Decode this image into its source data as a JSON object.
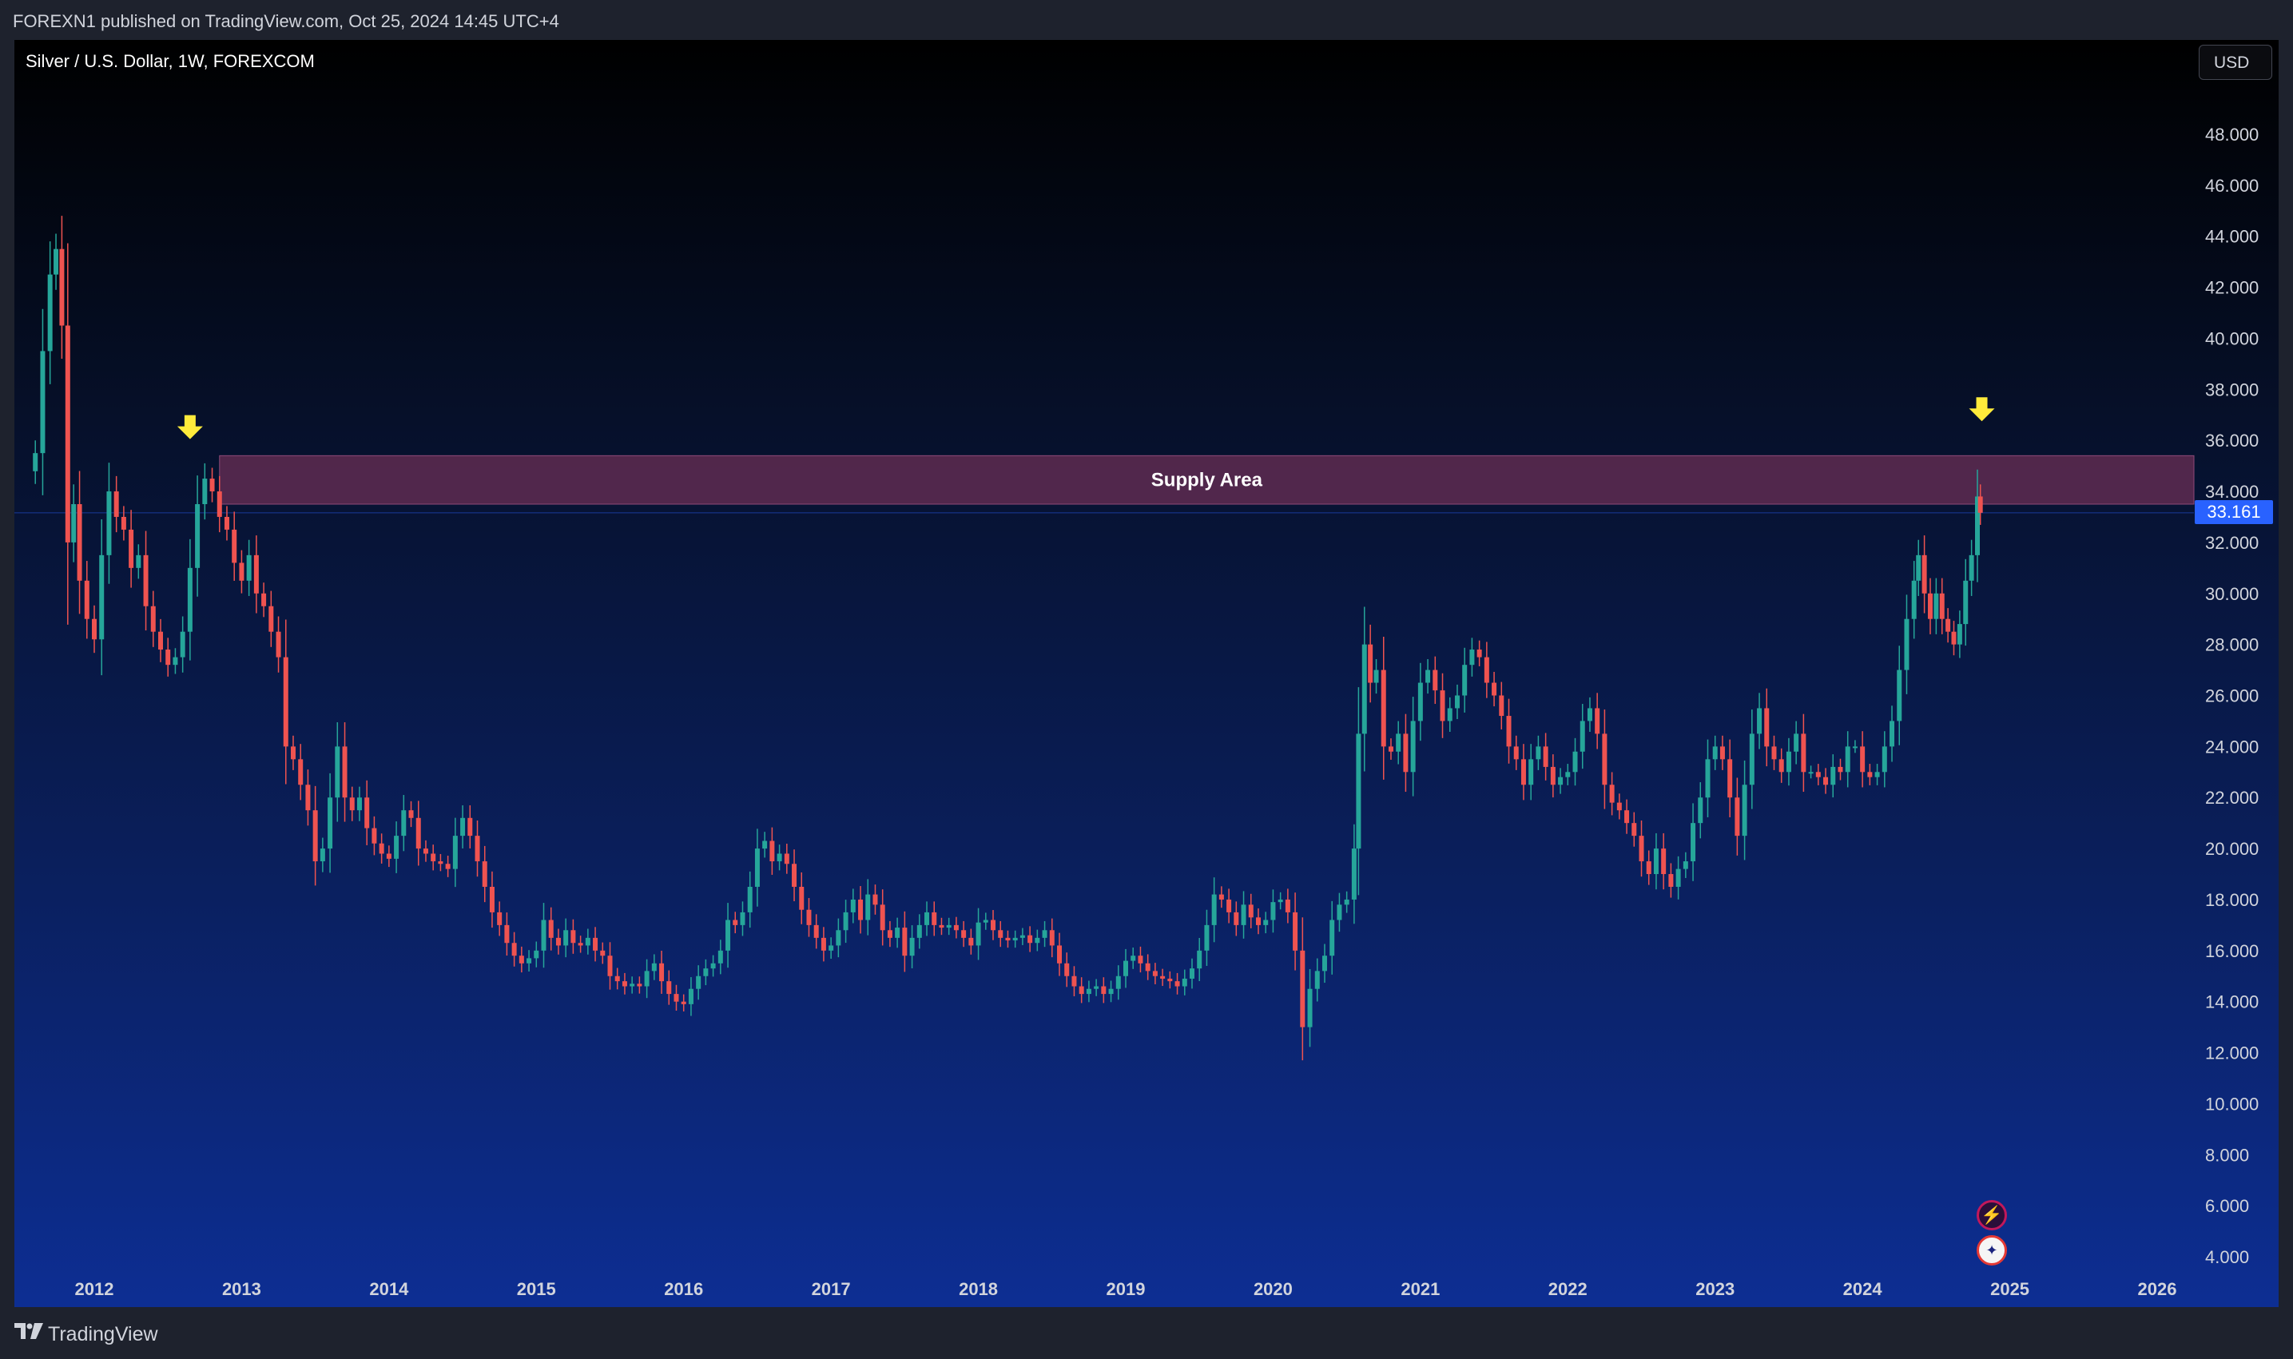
{
  "header": {
    "publish_text": "FOREXN1 published on TradingView.com, Oct 25, 2024 14:45 UTC+4"
  },
  "chart": {
    "symbol_title": "Silver / U.S. Dollar, 1W, FOREXCOM",
    "currency_label": "USD",
    "last_price_label": "33.161"
  },
  "footer": {
    "brand": "TradingView"
  },
  "icons": {
    "top_left": "tradingview-logo-icon",
    "events": [
      "lightning-icon",
      "us-flag-icon"
    ]
  },
  "colors": {
    "up_candle": "#26a69a",
    "down_candle": "#ef5350",
    "supply_zone_fill": "#6b2f55",
    "arrow": "#ffeb3b",
    "last_price": "#2962ff"
  },
  "chart_data": {
    "type": "candlestick",
    "title": "Silver / U.S. Dollar, 1W, FOREXCOM",
    "xlabel": "",
    "ylabel": "",
    "currency": "USD",
    "ylim": [
      4,
      50
    ],
    "yticks": [
      "48.000",
      "46.000",
      "44.000",
      "42.000",
      "40.000",
      "38.000",
      "36.000",
      "34.000",
      "32.000",
      "30.000",
      "28.000",
      "26.000",
      "24.000",
      "22.000",
      "20.000",
      "18.000",
      "16.000",
      "14.000",
      "12.000",
      "10.000",
      "8.000",
      "6.000",
      "4.000"
    ],
    "xlim": [
      2011.6,
      2026.3
    ],
    "xticks": [
      "2012",
      "2013",
      "2014",
      "2015",
      "2016",
      "2017",
      "2018",
      "2019",
      "2020",
      "2021",
      "2022",
      "2023",
      "2024",
      "2025",
      "2026"
    ],
    "last_price": 33.161,
    "series": [
      {
        "name": "",
        "points": [
          [
            2011.6,
            35.5
          ],
          [
            2011.65,
            39.5
          ],
          [
            2011.7,
            42.5
          ],
          [
            2011.74,
            43.5
          ],
          [
            2011.78,
            40.5
          ],
          [
            2011.82,
            32.0
          ],
          [
            2011.86,
            33.5
          ],
          [
            2011.9,
            30.5
          ],
          [
            2011.95,
            29.0
          ],
          [
            2012.0,
            28.2
          ],
          [
            2012.05,
            31.5
          ],
          [
            2012.1,
            34.0
          ],
          [
            2012.15,
            33.0
          ],
          [
            2012.2,
            32.5
          ],
          [
            2012.25,
            31.0
          ],
          [
            2012.3,
            31.5
          ],
          [
            2012.35,
            29.5
          ],
          [
            2012.4,
            28.5
          ],
          [
            2012.45,
            27.8
          ],
          [
            2012.5,
            27.2
          ],
          [
            2012.55,
            27.5
          ],
          [
            2012.6,
            28.5
          ],
          [
            2012.65,
            31.0
          ],
          [
            2012.7,
            33.5
          ],
          [
            2012.75,
            34.5
          ],
          [
            2012.8,
            34.0
          ],
          [
            2012.85,
            33.0
          ],
          [
            2012.9,
            32.5
          ],
          [
            2012.95,
            31.2
          ],
          [
            2013.0,
            30.5
          ],
          [
            2013.05,
            31.5
          ],
          [
            2013.1,
            30.0
          ],
          [
            2013.15,
            29.5
          ],
          [
            2013.2,
            28.5
          ],
          [
            2013.25,
            27.5
          ],
          [
            2013.3,
            24.0
          ],
          [
            2013.35,
            23.5
          ],
          [
            2013.4,
            22.5
          ],
          [
            2013.45,
            21.5
          ],
          [
            2013.5,
            19.5
          ],
          [
            2013.55,
            20.0
          ],
          [
            2013.6,
            22.0
          ],
          [
            2013.65,
            24.0
          ],
          [
            2013.7,
            22.0
          ],
          [
            2013.75,
            21.5
          ],
          [
            2013.8,
            22.0
          ],
          [
            2013.85,
            20.8
          ],
          [
            2013.9,
            20.2
          ],
          [
            2013.95,
            19.8
          ],
          [
            2014.0,
            19.6
          ],
          [
            2014.05,
            20.5
          ],
          [
            2014.1,
            21.5
          ],
          [
            2014.15,
            21.2
          ],
          [
            2014.2,
            20.0
          ],
          [
            2014.25,
            19.8
          ],
          [
            2014.3,
            19.5
          ],
          [
            2014.35,
            19.4
          ],
          [
            2014.4,
            19.2
          ],
          [
            2014.45,
            20.5
          ],
          [
            2014.5,
            21.2
          ],
          [
            2014.55,
            20.5
          ],
          [
            2014.6,
            19.5
          ],
          [
            2014.65,
            18.5
          ],
          [
            2014.7,
            17.5
          ],
          [
            2014.75,
            17.0
          ],
          [
            2014.8,
            16.3
          ],
          [
            2014.85,
            15.8
          ],
          [
            2014.9,
            15.5
          ],
          [
            2014.95,
            15.7
          ],
          [
            2015.0,
            16.0
          ],
          [
            2015.05,
            17.2
          ],
          [
            2015.1,
            16.5
          ],
          [
            2015.15,
            16.2
          ],
          [
            2015.2,
            16.8
          ],
          [
            2015.25,
            16.3
          ],
          [
            2015.3,
            16.2
          ],
          [
            2015.35,
            16.5
          ],
          [
            2015.4,
            16.0
          ],
          [
            2015.45,
            15.8
          ],
          [
            2015.5,
            15.0
          ],
          [
            2015.55,
            14.8
          ],
          [
            2015.6,
            14.6
          ],
          [
            2015.65,
            14.7
          ],
          [
            2015.7,
            14.6
          ],
          [
            2015.75,
            15.2
          ],
          [
            2015.8,
            15.5
          ],
          [
            2015.85,
            14.8
          ],
          [
            2015.9,
            14.3
          ],
          [
            2015.95,
            14.0
          ],
          [
            2016.0,
            13.9
          ],
          [
            2016.05,
            14.5
          ],
          [
            2016.1,
            15.0
          ],
          [
            2016.15,
            15.3
          ],
          [
            2016.2,
            15.5
          ],
          [
            2016.25,
            16.0
          ],
          [
            2016.3,
            17.2
          ],
          [
            2016.35,
            17.0
          ],
          [
            2016.4,
            17.5
          ],
          [
            2016.45,
            18.5
          ],
          [
            2016.5,
            20.0
          ],
          [
            2016.55,
            20.3
          ],
          [
            2016.6,
            19.5
          ],
          [
            2016.65,
            19.8
          ],
          [
            2016.7,
            19.4
          ],
          [
            2016.75,
            18.5
          ],
          [
            2016.8,
            17.6
          ],
          [
            2016.85,
            17.0
          ],
          [
            2016.9,
            16.5
          ],
          [
            2016.95,
            16.0
          ],
          [
            2017.0,
            16.2
          ],
          [
            2017.05,
            16.8
          ],
          [
            2017.1,
            17.5
          ],
          [
            2017.15,
            18.0
          ],
          [
            2017.2,
            17.2
          ],
          [
            2017.25,
            18.2
          ],
          [
            2017.3,
            17.8
          ],
          [
            2017.35,
            16.8
          ],
          [
            2017.4,
            16.5
          ],
          [
            2017.45,
            16.9
          ],
          [
            2017.5,
            15.8
          ],
          [
            2017.55,
            16.5
          ],
          [
            2017.6,
            17.0
          ],
          [
            2017.65,
            17.5
          ],
          [
            2017.7,
            17.0
          ],
          [
            2017.75,
            16.9
          ],
          [
            2017.8,
            17.0
          ],
          [
            2017.85,
            16.8
          ],
          [
            2017.9,
            16.5
          ],
          [
            2017.95,
            16.2
          ],
          [
            2018.0,
            17.1
          ],
          [
            2018.05,
            17.2
          ],
          [
            2018.1,
            16.8
          ],
          [
            2018.15,
            16.5
          ],
          [
            2018.2,
            16.4
          ],
          [
            2018.25,
            16.5
          ],
          [
            2018.3,
            16.6
          ],
          [
            2018.35,
            16.3
          ],
          [
            2018.4,
            16.5
          ],
          [
            2018.45,
            16.8
          ],
          [
            2018.5,
            16.2
          ],
          [
            2018.55,
            15.5
          ],
          [
            2018.6,
            15.0
          ],
          [
            2018.65,
            14.6
          ],
          [
            2018.7,
            14.3
          ],
          [
            2018.75,
            14.5
          ],
          [
            2018.8,
            14.6
          ],
          [
            2018.85,
            14.3
          ],
          [
            2018.9,
            14.5
          ],
          [
            2018.95,
            15.0
          ],
          [
            2019.0,
            15.6
          ],
          [
            2019.05,
            15.8
          ],
          [
            2019.1,
            15.5
          ],
          [
            2019.15,
            15.2
          ],
          [
            2019.2,
            15.0
          ],
          [
            2019.25,
            14.9
          ],
          [
            2019.3,
            14.8
          ],
          [
            2019.35,
            14.6
          ],
          [
            2019.4,
            14.9
          ],
          [
            2019.45,
            15.3
          ],
          [
            2019.5,
            16.0
          ],
          [
            2019.55,
            17.0
          ],
          [
            2019.6,
            18.2
          ],
          [
            2019.65,
            18.0
          ],
          [
            2019.7,
            17.5
          ],
          [
            2019.75,
            17.0
          ],
          [
            2019.8,
            17.8
          ],
          [
            2019.85,
            17.3
          ],
          [
            2019.9,
            17.0
          ],
          [
            2019.95,
            17.2
          ],
          [
            2020.0,
            17.9
          ],
          [
            2020.05,
            18.0
          ],
          [
            2020.1,
            17.5
          ],
          [
            2020.15,
            16.0
          ],
          [
            2020.2,
            13.0
          ],
          [
            2020.25,
            14.5
          ],
          [
            2020.3,
            15.2
          ],
          [
            2020.35,
            15.8
          ],
          [
            2020.4,
            17.2
          ],
          [
            2020.45,
            17.8
          ],
          [
            2020.5,
            18.0
          ],
          [
            2020.55,
            20.0
          ],
          [
            2020.58,
            24.5
          ],
          [
            2020.62,
            28.0
          ],
          [
            2020.66,
            26.5
          ],
          [
            2020.7,
            27.0
          ],
          [
            2020.75,
            24.0
          ],
          [
            2020.8,
            23.8
          ],
          [
            2020.85,
            24.5
          ],
          [
            2020.9,
            23.0
          ],
          [
            2020.95,
            25.0
          ],
          [
            2021.0,
            26.5
          ],
          [
            2021.05,
            27.0
          ],
          [
            2021.1,
            26.2
          ],
          [
            2021.15,
            25.0
          ],
          [
            2021.2,
            25.5
          ],
          [
            2021.25,
            26.0
          ],
          [
            2021.3,
            27.2
          ],
          [
            2021.35,
            27.8
          ],
          [
            2021.4,
            27.5
          ],
          [
            2021.45,
            26.5
          ],
          [
            2021.5,
            26.0
          ],
          [
            2021.55,
            25.2
          ],
          [
            2021.6,
            24.0
          ],
          [
            2021.65,
            23.5
          ],
          [
            2021.7,
            22.5
          ],
          [
            2021.75,
            23.5
          ],
          [
            2021.8,
            24.0
          ],
          [
            2021.85,
            23.2
          ],
          [
            2021.9,
            22.5
          ],
          [
            2021.95,
            22.8
          ],
          [
            2022.0,
            23.0
          ],
          [
            2022.05,
            23.8
          ],
          [
            2022.1,
            25.0
          ],
          [
            2022.15,
            25.5
          ],
          [
            2022.2,
            24.5
          ],
          [
            2022.25,
            22.5
          ],
          [
            2022.3,
            21.8
          ],
          [
            2022.35,
            21.5
          ],
          [
            2022.4,
            21.0
          ],
          [
            2022.45,
            20.5
          ],
          [
            2022.5,
            19.5
          ],
          [
            2022.55,
            19.0
          ],
          [
            2022.6,
            20.0
          ],
          [
            2022.65,
            19.0
          ],
          [
            2022.7,
            18.5
          ],
          [
            2022.75,
            19.2
          ],
          [
            2022.8,
            19.5
          ],
          [
            2022.85,
            21.0
          ],
          [
            2022.9,
            22.0
          ],
          [
            2022.95,
            23.5
          ],
          [
            2023.0,
            24.0
          ],
          [
            2023.05,
            23.5
          ],
          [
            2023.1,
            22.0
          ],
          [
            2023.15,
            20.5
          ],
          [
            2023.2,
            22.5
          ],
          [
            2023.25,
            24.5
          ],
          [
            2023.3,
            25.5
          ],
          [
            2023.35,
            24.0
          ],
          [
            2023.4,
            23.5
          ],
          [
            2023.45,
            23.0
          ],
          [
            2023.5,
            23.8
          ],
          [
            2023.55,
            24.5
          ],
          [
            2023.6,
            23.0
          ],
          [
            2023.65,
            23.0
          ],
          [
            2023.7,
            22.8
          ],
          [
            2023.75,
            22.5
          ],
          [
            2023.8,
            23.2
          ],
          [
            2023.85,
            23.0
          ],
          [
            2023.9,
            24.0
          ],
          [
            2023.95,
            24.0
          ],
          [
            2024.0,
            23.0
          ],
          [
            2024.05,
            22.8
          ],
          [
            2024.1,
            23.0
          ],
          [
            2024.15,
            24.0
          ],
          [
            2024.2,
            25.0
          ],
          [
            2024.25,
            27.0
          ],
          [
            2024.3,
            29.0
          ],
          [
            2024.35,
            30.5
          ],
          [
            2024.38,
            31.5
          ],
          [
            2024.42,
            30.0
          ],
          [
            2024.46,
            29.0
          ],
          [
            2024.5,
            30.0
          ],
          [
            2024.54,
            29.0
          ],
          [
            2024.58,
            28.5
          ],
          [
            2024.62,
            28.0
          ],
          [
            2024.66,
            28.8
          ],
          [
            2024.7,
            30.5
          ],
          [
            2024.74,
            31.5
          ],
          [
            2024.78,
            33.8
          ],
          [
            2024.8,
            33.161
          ]
        ]
      }
    ],
    "zones": [
      {
        "label": "Supply Area",
        "x_start": 2012.85,
        "x_end": 2026.3,
        "y_low": 33.5,
        "y_high": 35.4
      }
    ],
    "annotations": [
      {
        "type": "down-arrow",
        "x": 2012.65,
        "y": 36.3
      },
      {
        "type": "down-arrow",
        "x": 2024.81,
        "y": 37.0
      }
    ]
  }
}
